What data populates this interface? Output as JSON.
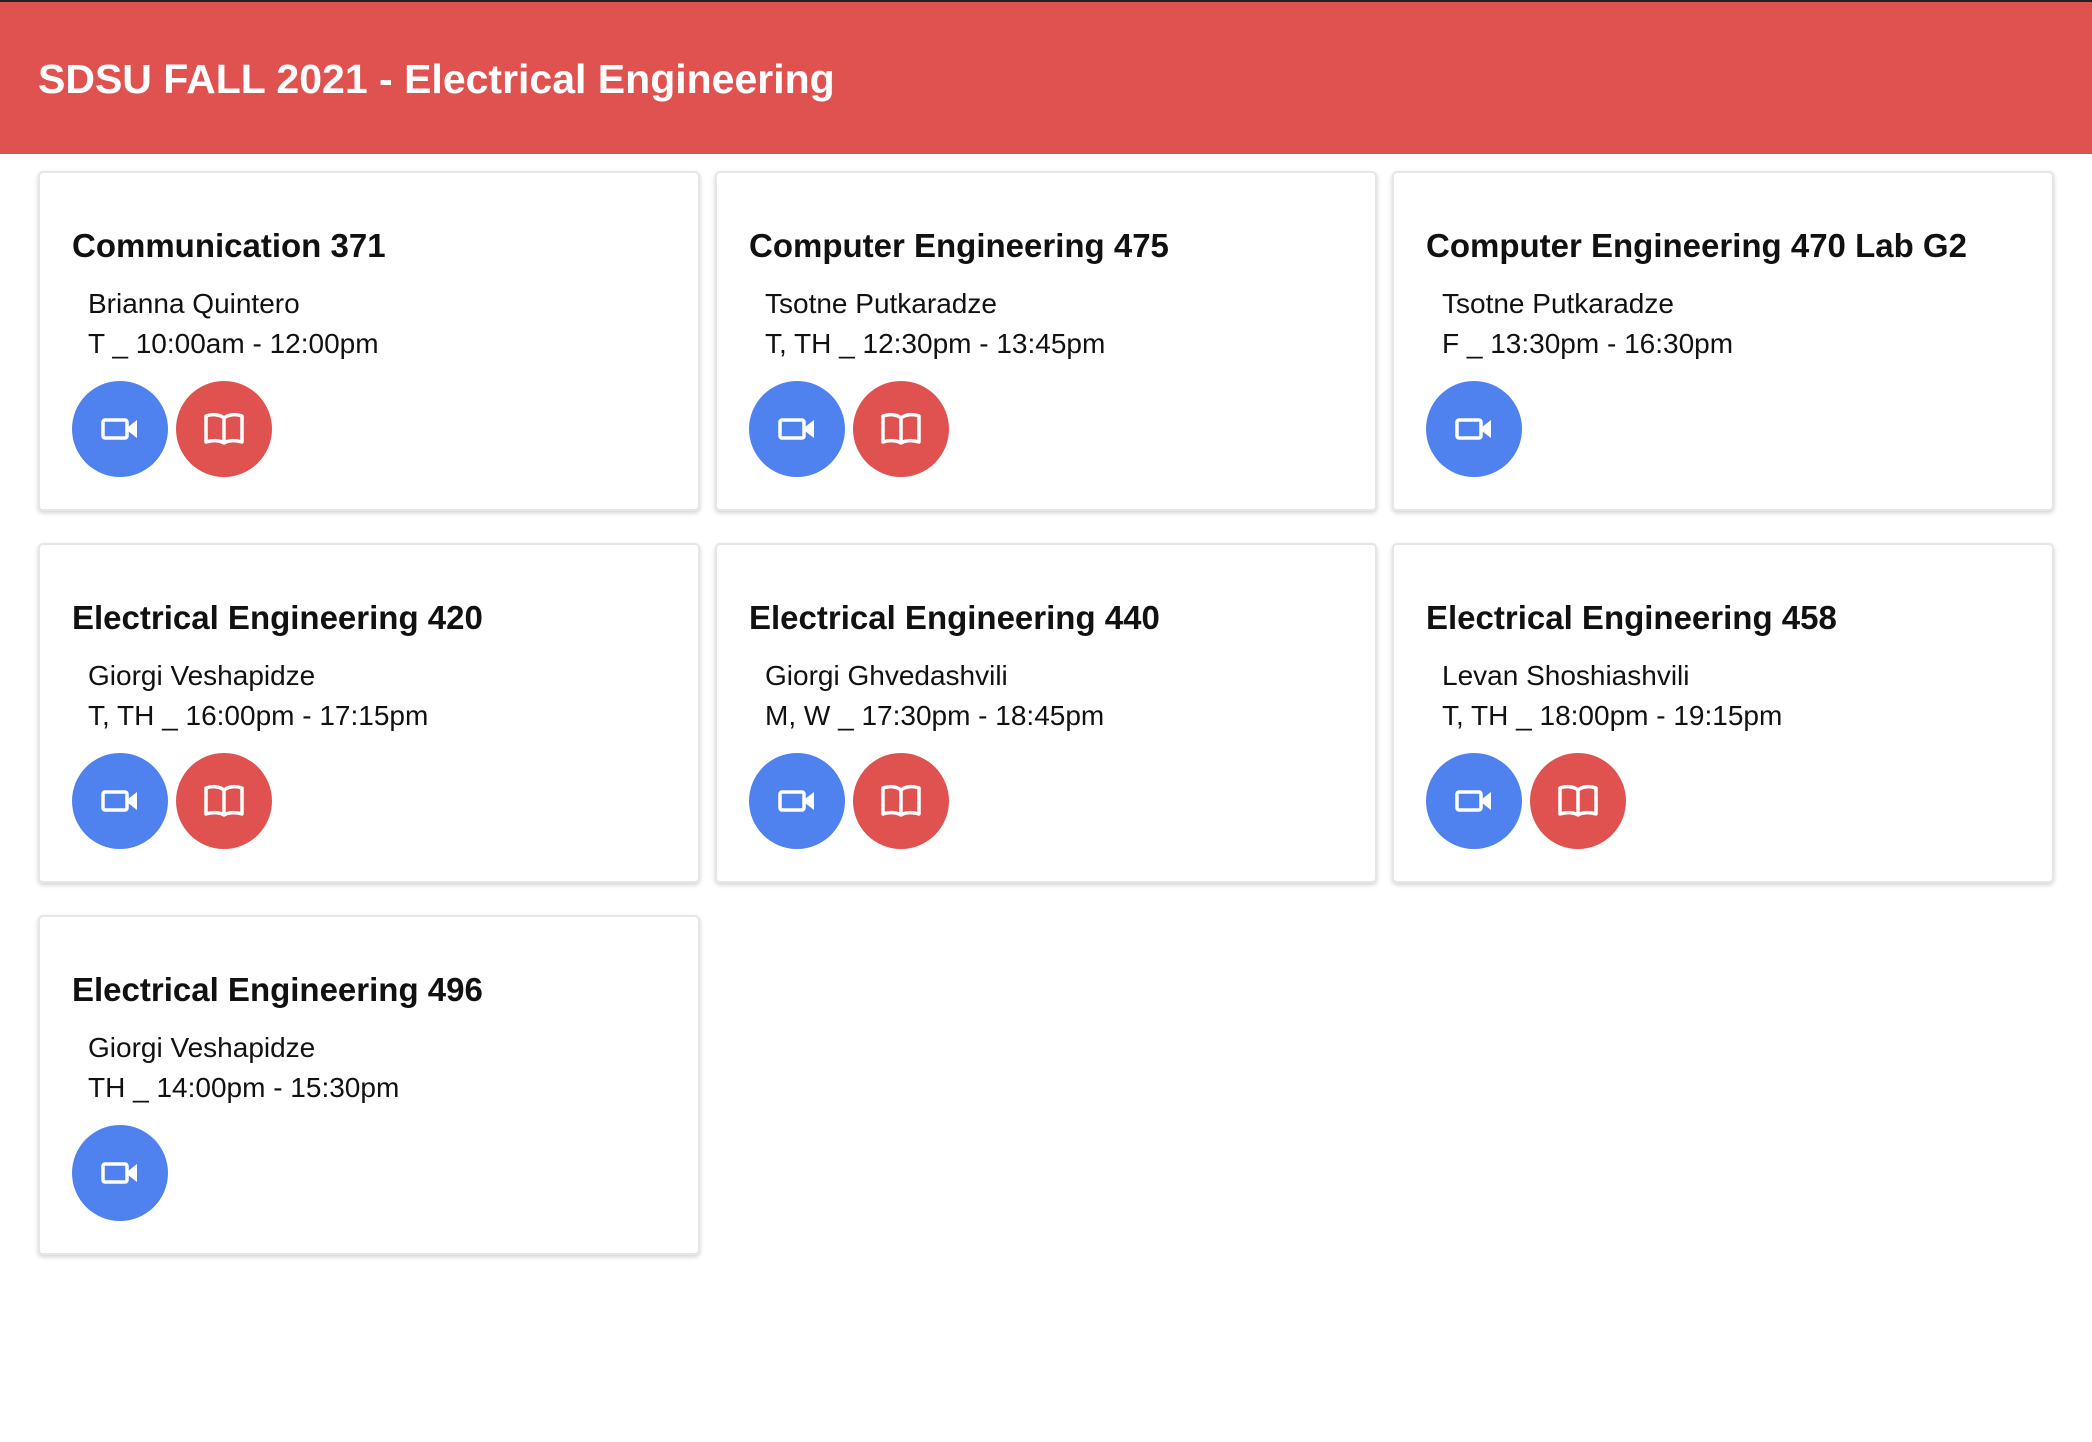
{
  "header": {
    "title": "SDSU FALL 2021 - Electrical Engineering",
    "background": "#df524f"
  },
  "colors": {
    "video_button": "#4f82ee",
    "book_button": "#df524f"
  },
  "courses": [
    {
      "title": "Communication 371",
      "instructor": "Brianna Quintero",
      "schedule": "T _ 10:00am - 12:00pm",
      "buttons": [
        "video-icon",
        "book-icon"
      ]
    },
    {
      "title": "Computer Engineering 475",
      "instructor": "Tsotne Putkaradze",
      "schedule": "T, TH _ 12:30pm - 13:45pm",
      "buttons": [
        "video-icon",
        "book-icon"
      ]
    },
    {
      "title": "Computer Engineering 470 Lab G2",
      "instructor": "Tsotne Putkaradze",
      "schedule": "F _ 13:30pm - 16:30pm",
      "buttons": [
        "video-icon"
      ]
    },
    {
      "title": "Electrical Engineering 420",
      "instructor": "Giorgi Veshapidze",
      "schedule": "T, TH _ 16:00pm - 17:15pm",
      "buttons": [
        "video-icon",
        "book-icon"
      ]
    },
    {
      "title": "Electrical Engineering 440",
      "instructor": "Giorgi Ghvedashvili",
      "schedule": "M, W _ 17:30pm - 18:45pm",
      "buttons": [
        "video-icon",
        "book-icon"
      ]
    },
    {
      "title": "Electrical Engineering 458",
      "instructor": "Levan Shoshiashvili",
      "schedule": "T, TH _ 18:00pm - 19:15pm",
      "buttons": [
        "video-icon",
        "book-icon"
      ]
    },
    {
      "title": "Electrical Engineering 496",
      "instructor": "Giorgi Veshapidze",
      "schedule": "TH _ 14:00pm - 15:30pm",
      "buttons": [
        "video-icon"
      ]
    }
  ]
}
